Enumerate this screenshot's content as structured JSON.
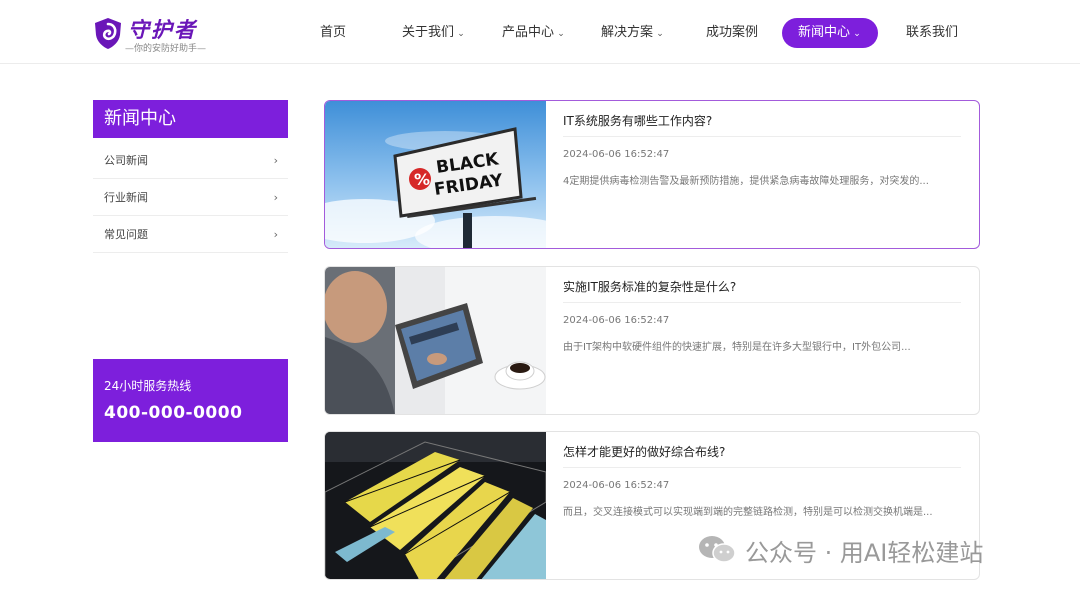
{
  "brand": {
    "name": "守护者",
    "tagline": "—你的安防好助手—",
    "primary_color": "#7d1fdc"
  },
  "nav": {
    "items": [
      {
        "label": "首页",
        "has_dropdown": false
      },
      {
        "label": "关于我们",
        "has_dropdown": true
      },
      {
        "label": "产品中心",
        "has_dropdown": true
      },
      {
        "label": "解决方案",
        "has_dropdown": true
      },
      {
        "label": "成功案例",
        "has_dropdown": false
      },
      {
        "label": "新闻中心",
        "has_dropdown": true,
        "active": true
      },
      {
        "label": "联系我们",
        "has_dropdown": false
      }
    ],
    "chevron_icon": "chevron-down-icon"
  },
  "sidebar": {
    "title": "新闻中心",
    "items": [
      {
        "label": "公司新闻"
      },
      {
        "label": "行业新闻"
      },
      {
        "label": "常见问题"
      }
    ],
    "arrow_icon": "chevron-right-icon"
  },
  "hotline": {
    "label": "24小时服务热线",
    "number": "400-000-0000"
  },
  "news": [
    {
      "title": "IT系统服务有哪些工作内容?",
      "date": "2024-06-06 16:52:47",
      "summary": "4定期提供病毒检测告警及最新预防措施，提供紧急病毒故障处理服务，对突发的...",
      "image": "black-friday-billboard"
    },
    {
      "title": "实施IT服务标准的复杂性是什么?",
      "date": "2024-06-06 16:52:47",
      "summary": "由于IT架构中软硬件组件的快速扩展，特别是在许多大型银行中，IT外包公司...",
      "image": "tablet-user-with-coffee"
    },
    {
      "title": "怎样才能更好的做好综合布线?",
      "date": "2024-06-06 16:52:47",
      "summary": "而且，交叉连接模式可以实现端到端的完整链路检测，特别是可以检测交换机端是...",
      "image": "data-center-cabling"
    }
  ],
  "watermark": {
    "text": "公众号 · 用AI轻松建站"
  }
}
